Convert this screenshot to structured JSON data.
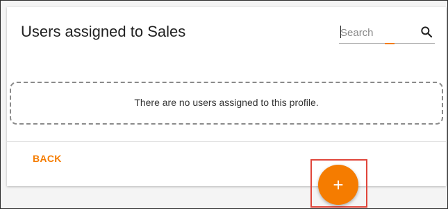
{
  "header": {
    "title": "Users assigned to Sales"
  },
  "search": {
    "placeholder": "Search",
    "value": "",
    "icon": "search-icon"
  },
  "empty_state": {
    "message": "There are no users assigned to this profile."
  },
  "footer": {
    "back_label": "BACK"
  },
  "fab": {
    "label": "+",
    "icon": "plus-icon"
  },
  "colors": {
    "accent": "#f57c00",
    "highlight": "#e0453a"
  }
}
